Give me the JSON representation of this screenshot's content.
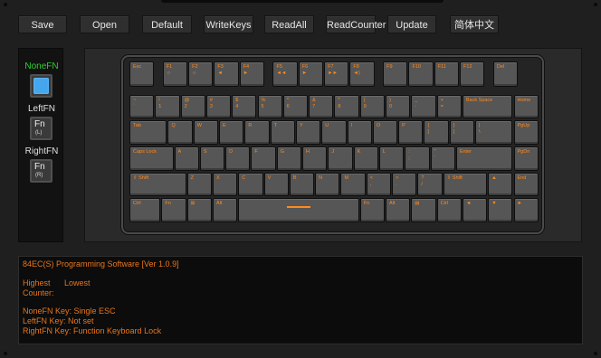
{
  "toolbar": {
    "buttons": [
      {
        "id": "save",
        "label": "Save"
      },
      {
        "id": "open",
        "label": "Open"
      },
      {
        "id": "default",
        "label": "Default"
      },
      {
        "id": "writekeys",
        "label": "WriteKeys"
      },
      {
        "id": "readall",
        "label": "ReadAll"
      },
      {
        "id": "readcounter",
        "label": "ReadCounter"
      },
      {
        "id": "update",
        "label": "Update"
      },
      {
        "id": "chinese",
        "label": "简体中文"
      }
    ]
  },
  "fn_panel": {
    "none_fn": {
      "label": "NoneFN",
      "state": "selected",
      "color": "#45a6ee"
    },
    "left_fn": {
      "label": "LeftFN",
      "key": "Fn",
      "sub": "(L)"
    },
    "right_fn": {
      "label": "RightFN",
      "key": "Fn",
      "sub": "(R)"
    }
  },
  "keyboard": {
    "legend_color": "#ff8a1e",
    "row0": [
      {
        "l1": "Esc",
        "l2": ""
      },
      {
        "l1": "F1",
        "l2": "☼"
      },
      {
        "l1": "F2",
        "l2": "☼"
      },
      {
        "l1": "F3",
        "l2": "◄"
      },
      {
        "l1": "F4",
        "l2": "►"
      },
      {
        "l1": "F5",
        "l2": "◄◄"
      },
      {
        "l1": "F6",
        "l2": "►"
      },
      {
        "l1": "F7",
        "l2": "►►"
      },
      {
        "l1": "F8",
        "l2": "◄)"
      },
      {
        "l1": "F9",
        "l2": ""
      },
      {
        "l1": "F10",
        "l2": ""
      },
      {
        "l1": "F11",
        "l2": ""
      },
      {
        "l1": "F12",
        "l2": ""
      },
      {
        "l1": "Del",
        "l2": ""
      }
    ],
    "row1": [
      {
        "l1": "~",
        "l2": "`"
      },
      {
        "l1": "!",
        "l2": "1"
      },
      {
        "l1": "@",
        "l2": "2"
      },
      {
        "l1": "#",
        "l2": "3"
      },
      {
        "l1": "$",
        "l2": "4"
      },
      {
        "l1": "%",
        "l2": "5"
      },
      {
        "l1": "^",
        "l2": "6"
      },
      {
        "l1": "&",
        "l2": "7"
      },
      {
        "l1": "*",
        "l2": "8"
      },
      {
        "l1": "(",
        "l2": "9"
      },
      {
        "l1": ")",
        "l2": "0"
      },
      {
        "l1": "_",
        "l2": "-"
      },
      {
        "l1": "+",
        "l2": "="
      },
      {
        "l1": "Back Space",
        "l2": ""
      },
      {
        "l1": "Home",
        "l2": ""
      }
    ],
    "row2": [
      {
        "l1": "Tab",
        "l2": ""
      },
      {
        "l1": "Q",
        "l2": ""
      },
      {
        "l1": "W",
        "l2": ""
      },
      {
        "l1": "E",
        "l2": ""
      },
      {
        "l1": "R",
        "l2": ""
      },
      {
        "l1": "T",
        "l2": ""
      },
      {
        "l1": "Y",
        "l2": ""
      },
      {
        "l1": "U",
        "l2": ""
      },
      {
        "l1": "I",
        "l2": ""
      },
      {
        "l1": "O",
        "l2": ""
      },
      {
        "l1": "P",
        "l2": ""
      },
      {
        "l1": "{",
        "l2": "["
      },
      {
        "l1": "}",
        "l2": "]"
      },
      {
        "l1": "|",
        "l2": "\\"
      },
      {
        "l1": "PgUp",
        "l2": ""
      }
    ],
    "row3": [
      {
        "l1": "Caps Lock",
        "l2": ""
      },
      {
        "l1": "A",
        "l2": ""
      },
      {
        "l1": "S",
        "l2": ""
      },
      {
        "l1": "D",
        "l2": ""
      },
      {
        "l1": "F",
        "l2": ""
      },
      {
        "l1": "G",
        "l2": ""
      },
      {
        "l1": "H",
        "l2": ""
      },
      {
        "l1": "J",
        "l2": ""
      },
      {
        "l1": "K",
        "l2": ""
      },
      {
        "l1": "L",
        "l2": ""
      },
      {
        "l1": ":",
        "l2": ";"
      },
      {
        "l1": "\"",
        "l2": "'"
      },
      {
        "l1": "Enter",
        "l2": ""
      },
      {
        "l1": "PgDn",
        "l2": ""
      }
    ],
    "row4": [
      {
        "l1": "⇧ Shift",
        "l2": ""
      },
      {
        "l1": "Z",
        "l2": ""
      },
      {
        "l1": "X",
        "l2": ""
      },
      {
        "l1": "C",
        "l2": ""
      },
      {
        "l1": "V",
        "l2": ""
      },
      {
        "l1": "B",
        "l2": ""
      },
      {
        "l1": "N",
        "l2": ""
      },
      {
        "l1": "M",
        "l2": ""
      },
      {
        "l1": "<",
        "l2": ","
      },
      {
        "l1": ">",
        "l2": "."
      },
      {
        "l1": "?",
        "l2": "/"
      },
      {
        "l1": "⇧ Shift",
        "l2": ""
      },
      {
        "l1": "▲",
        "l2": ""
      },
      {
        "l1": "End",
        "l2": ""
      }
    ],
    "row5": [
      {
        "l1": "Ctrl",
        "l2": ""
      },
      {
        "l1": "Fn",
        "l2": ""
      },
      {
        "l1": "⊞",
        "l2": ""
      },
      {
        "l1": "Alt",
        "l2": ""
      },
      {
        "l1": "",
        "l2": ""
      },
      {
        "l1": "Fn",
        "l2": ""
      },
      {
        "l1": "Alt",
        "l2": ""
      },
      {
        "l1": "▤",
        "l2": ""
      },
      {
        "l1": "Ctrl",
        "l2": ""
      },
      {
        "l1": "◄",
        "l2": ""
      },
      {
        "l1": "▼",
        "l2": ""
      },
      {
        "l1": "►",
        "l2": ""
      }
    ]
  },
  "console": {
    "title": "84EC(S) Programming Software [Ver 1.0.9]",
    "highest": "Highest",
    "lowest": "Lowest",
    "counter": "Counter:",
    "nonefn": "NoneFN Key:  Single ESC",
    "leftfn": "LeftFN Key:  Not set",
    "rightfn": "RightFN Key:  Function Keyboard Lock"
  }
}
